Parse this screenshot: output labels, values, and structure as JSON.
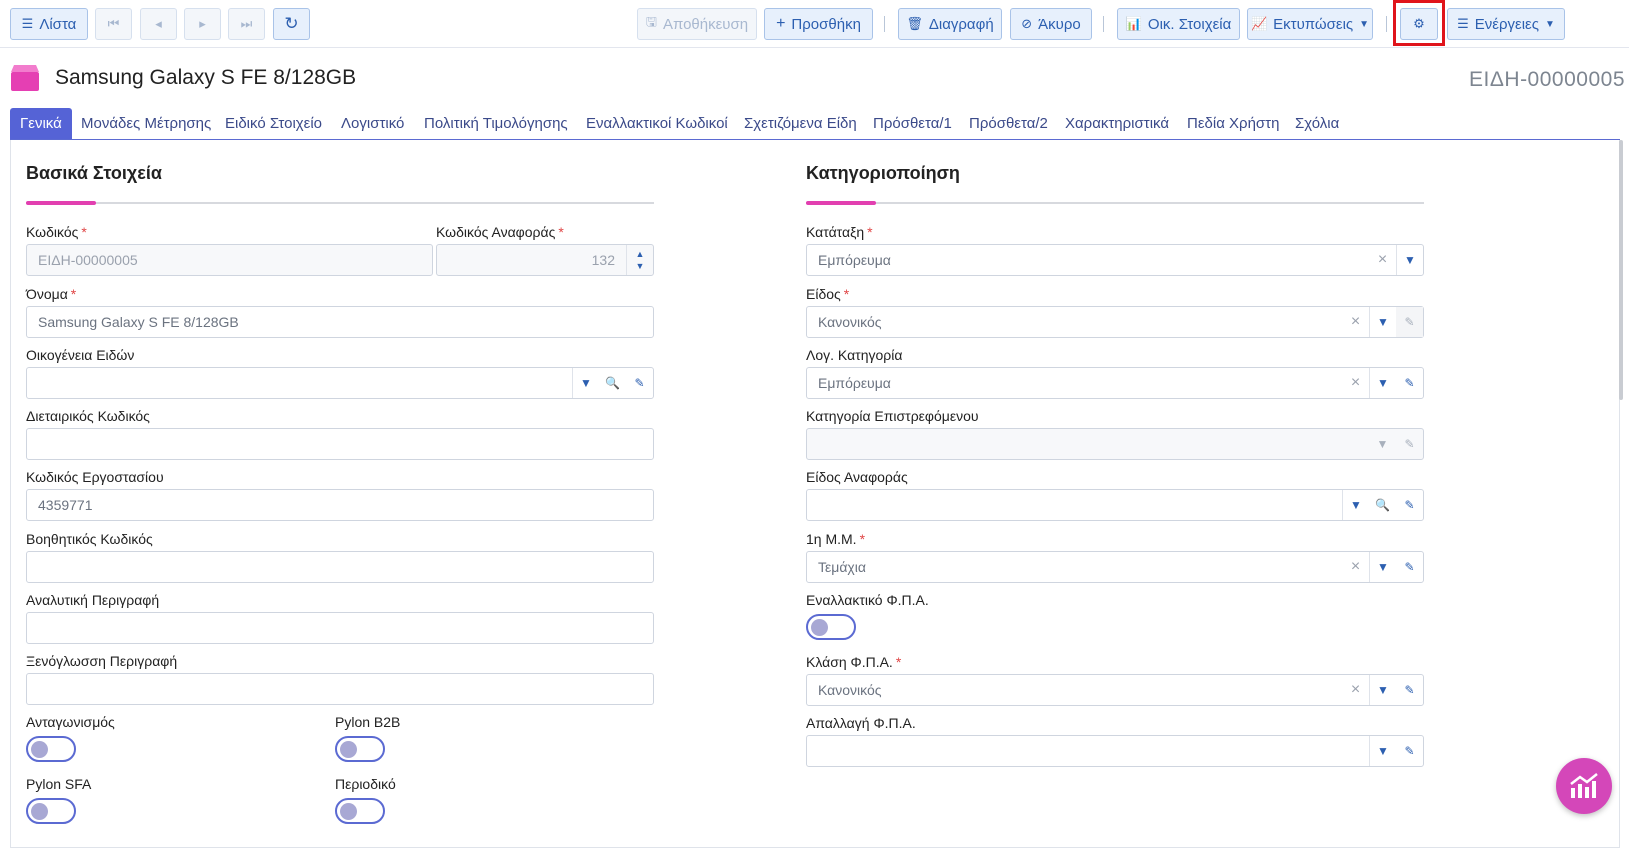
{
  "toolbar": {
    "list_label": "Λίστα",
    "save_label": "Αποθήκευση",
    "add_label": "Προσθήκη",
    "delete_label": "Διαγραφή",
    "cancel_label": "Άκυρο",
    "financials_label": "Οικ. Στοιχεία",
    "prints_label": "Εκτυπώσεις",
    "actions_label": "Ενέργειες"
  },
  "header": {
    "title": "Samsung Galaxy S FE 8/128GB",
    "code": "ΕΙΔΗ-00000005"
  },
  "tabs": [
    {
      "label": "Γενικά",
      "active": true
    },
    {
      "label": "Μονάδες Μέτρησης"
    },
    {
      "label": "Ειδικό Στοιχείο"
    },
    {
      "label": "Λογιστικό"
    },
    {
      "label": "Πολιτική Τιμολόγησης"
    },
    {
      "label": "Εναλλακτικοί Κωδικοί"
    },
    {
      "label": "Σχετιζόμενα Είδη"
    },
    {
      "label": "Πρόσθετα/1"
    },
    {
      "label": "Πρόσθετα/2"
    },
    {
      "label": "Χαρακτηριστικά"
    },
    {
      "label": "Πεδία Χρήστη"
    },
    {
      "label": "Σχόλια"
    }
  ],
  "basic": {
    "section_title": "Βασικά Στοιχεία",
    "code_label": "Κωδικός",
    "code_value": "ΕΙΔΗ-00000005",
    "ref_code_label": "Κωδικός Αναφοράς",
    "ref_code_value": "132",
    "name_label": "Όνομα",
    "name_value": "Samsung Galaxy S FE 8/128GB",
    "family_label": "Οικογένεια Ειδών",
    "family_value": "",
    "intl_code_label": "Διεταιρικός Κωδικός",
    "intl_code_value": "",
    "factory_code_label": "Κωδικός Εργοστασίου",
    "factory_code_value": "4359771",
    "aux_code_label": "Βοηθητικός Κωδικός",
    "aux_code_value": "",
    "analytic_desc_label": "Αναλυτική Περιγραφή",
    "analytic_desc_value": "",
    "foreign_desc_label": "Ξενόγλωσση Περιγραφή",
    "foreign_desc_value": "",
    "competition_label": "Ανταγωνισμός",
    "b2b_label": "Pylon B2B",
    "sfa_label": "Pylon SFA",
    "periodical_label": "Περιοδικό"
  },
  "category": {
    "section_title": "Κατηγοριοποίηση",
    "classification_label": "Κατάταξη",
    "classification_value": "Εμπόρευμα",
    "type_label": "Είδος",
    "type_value": "Κανονικός",
    "acc_category_label": "Λογ. Κατηγορία",
    "acc_category_value": "Εμπόρευμα",
    "return_category_label": "Κατηγορία Επιστρεφόμενου",
    "return_category_value": "",
    "ref_item_label": "Είδος Αναφοράς",
    "ref_item_value": "",
    "unit_label": "1η Μ.Μ.",
    "unit_value": "Τεμάχια",
    "alt_vat_label": "Εναλλακτικό Φ.Π.Α.",
    "vat_class_label": "Κλάση Φ.Π.Α.",
    "vat_class_value": "Κανονικός",
    "vat_exempt_label": "Απαλλαγή Φ.Π.Α.",
    "vat_exempt_value": ""
  },
  "colors": {
    "accent": "#5563d6",
    "pink": "#e23fb0",
    "button_bg": "#e7f0fc",
    "button_text": "#2c5fb0"
  }
}
